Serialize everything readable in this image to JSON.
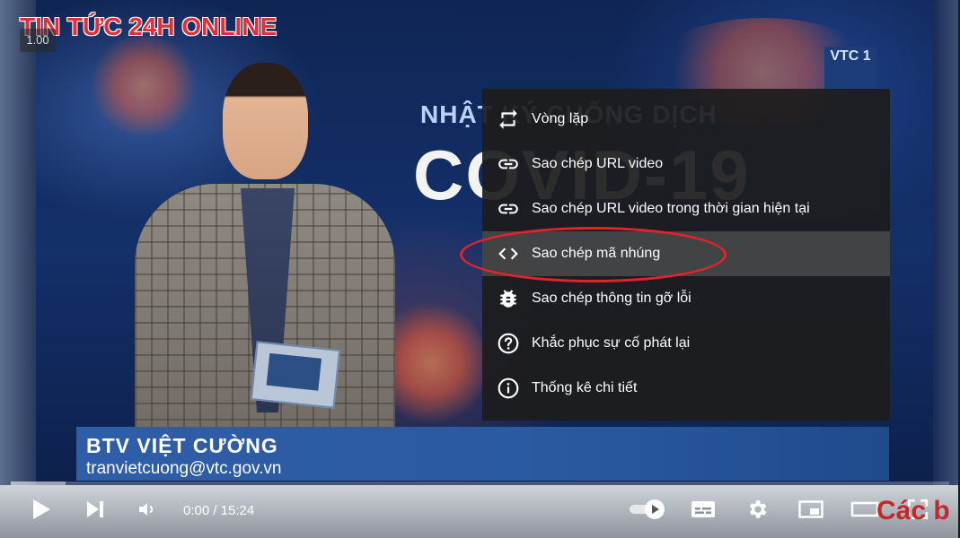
{
  "video": {
    "brand_overlay": "TIN TỨC 24H ONLINE",
    "speed_badge": "1.00",
    "headline_small": "NHẬT KÝ CHỐNG DỊCH",
    "headline_big": "COVID-19",
    "channel_logo": "VTC 1",
    "lower_third": {
      "name": "BTV VIỆT CƯỜNG",
      "email": "tranvietcuong@vtc.gov.vn"
    }
  },
  "context_menu": {
    "items": [
      {
        "label": "Vòng lặp",
        "icon": "loop-icon"
      },
      {
        "label": "Sao chép URL video",
        "icon": "link-icon"
      },
      {
        "label": "Sao chép URL video trong thời gian hiện tại",
        "icon": "link-icon"
      },
      {
        "label": "Sao chép mã nhúng",
        "icon": "embed-code-icon"
      },
      {
        "label": "Sao chép thông tin gỡ lỗi",
        "icon": "debug-icon"
      },
      {
        "label": "Khắc phục sự cố phát lại",
        "icon": "help-circle-icon"
      },
      {
        "label": "Thống kê chi tiết",
        "icon": "info-circle-icon"
      }
    ],
    "highlighted_index": 3
  },
  "controls": {
    "time_display": "0:00 / 15:24",
    "corner_text": "Các b",
    "buffered_fraction": 0.058
  },
  "colors": {
    "menu_bg": "#1c1c1c",
    "highlight_ring": "#e3232b",
    "brand_red": "#e02f3a"
  }
}
